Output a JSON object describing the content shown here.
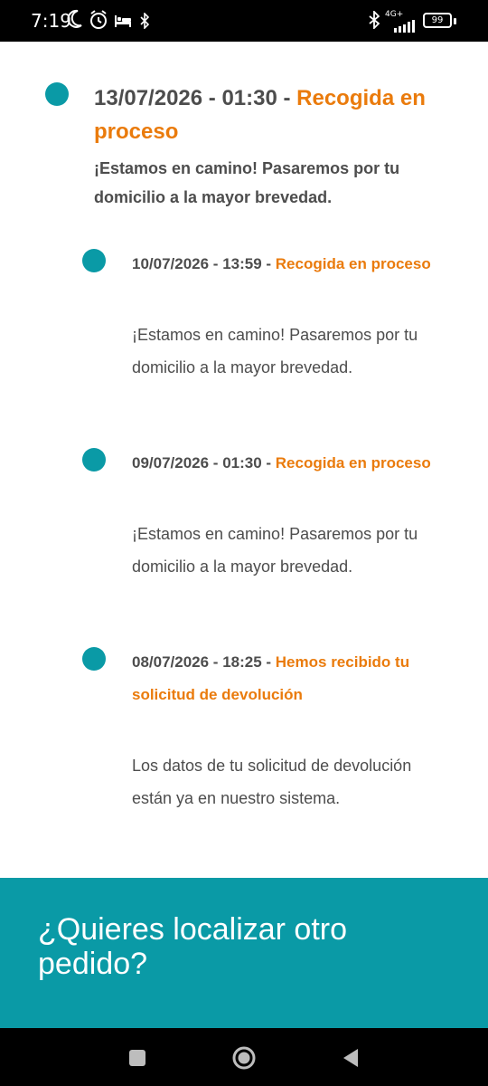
{
  "status_bar": {
    "time": "7:19",
    "network": "4G+",
    "battery": "99",
    "icons": [
      "moon-icon",
      "alarm-icon",
      "bed-icon",
      "bluetooth-icon",
      "signal-icon",
      "battery-icon"
    ]
  },
  "events": [
    {
      "date": "13/07/2026 - 01:30",
      "separator": " - ",
      "status": "Recogida en proceso",
      "text": "¡Estamos en camino! Pasaremos por tu domicilio a la mayor brevedad."
    },
    {
      "date": "10/07/2026 - 13:59",
      "separator": " - ",
      "status": "Recogida en proceso",
      "text": "¡Estamos en camino! Pasaremos por tu domicilio a la mayor brevedad."
    },
    {
      "date": "09/07/2026 - 01:30",
      "separator": " - ",
      "status": "Recogida en proceso",
      "text": "¡Estamos en camino! Pasaremos por tu domicilio a la mayor brevedad."
    },
    {
      "date": "08/07/2026 - 18:25",
      "separator": " - ",
      "status": "Hemos recibido tu solicitud de devolución",
      "text": "Los datos de tu solicitud de devolución están ya en nuestro sistema."
    }
  ],
  "cta": {
    "title": "¿Quieres localizar otro pedido?"
  },
  "colors": {
    "accent": "#0a9aa6",
    "status": "#ea7b0c",
    "text": "#4d4d4d"
  },
  "nav": {
    "icons": [
      "recents-icon",
      "home-icon",
      "back-icon"
    ]
  }
}
